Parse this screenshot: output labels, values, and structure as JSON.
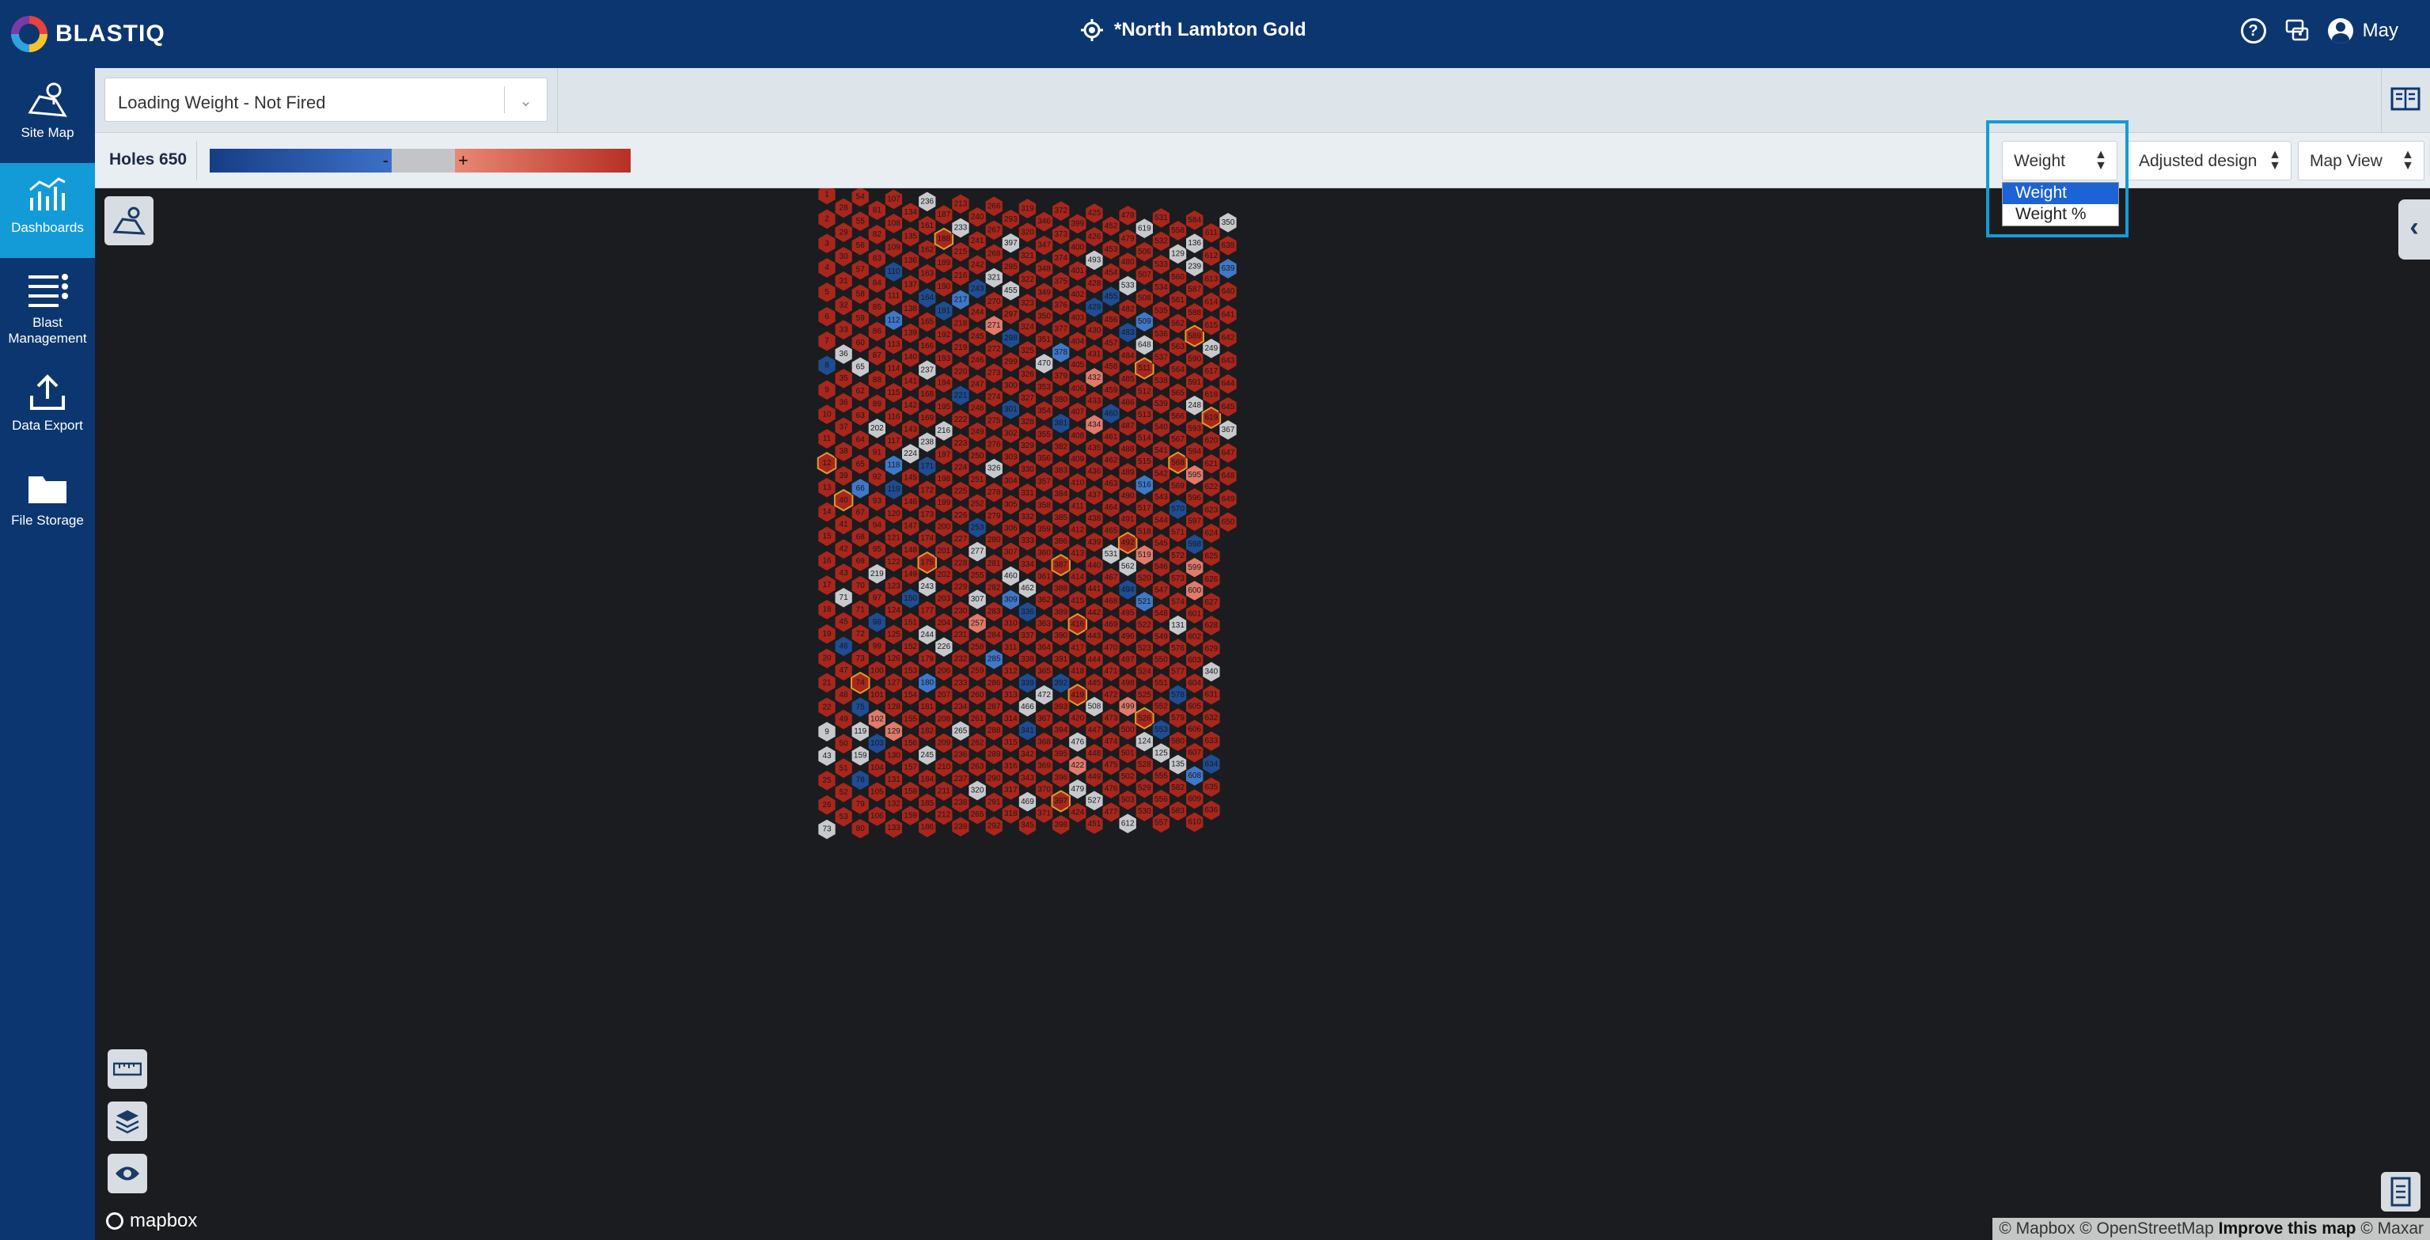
{
  "app": {
    "logo_text": "BLASTIQ",
    "site_title": "*North Lambton Gold",
    "user_name": "May"
  },
  "sidebar": {
    "items": [
      {
        "label": "Site Map",
        "icon": "map-marker-icon"
      },
      {
        "label": "Dashboards",
        "icon": "dashboard-chart-icon"
      },
      {
        "label": "Blast Management",
        "icon": "list-settings-icon"
      },
      {
        "label": "Data Export",
        "icon": "upload-icon"
      },
      {
        "label": "File Storage",
        "icon": "folder-icon"
      }
    ]
  },
  "toolbar": {
    "dashboard_select": "Loading Weight - Not Fired"
  },
  "legend": {
    "holes_label": "Holes 650",
    "minus": "-",
    "plus": "+"
  },
  "controls": {
    "metric_select": "Weight",
    "metric_options": [
      "Weight",
      "Weight %"
    ],
    "design_select": "Adjusted design",
    "view_select": "Map View"
  },
  "map": {
    "mapbox_label": "mapbox",
    "attribution_a": "© Mapbox © OpenStreetMap",
    "attribution_b": "Improve this map",
    "attribution_c": "© Maxar"
  },
  "colors": {
    "header": "#0c3670",
    "active_nav": "#139bd8",
    "over": "#a8261c",
    "near": "#e07a6b",
    "under": "#1f4c92",
    "under_light": "#3f78c9",
    "target": "#c7c9cc",
    "outline": "#e49a2a"
  },
  "hole_map": {
    "total": 650,
    "visible_labels": [
      "9",
      "43",
      "73",
      "36",
      "71",
      "65",
      "119",
      "159",
      "202",
      "219",
      "224",
      "236",
      "237",
      "238",
      "243",
      "244",
      "245",
      "216",
      "226",
      "233",
      "265",
      "277",
      "307",
      "320",
      "321",
      "326",
      "397",
      "455",
      "460",
      "462",
      "466",
      "469",
      "470",
      "472",
      "476",
      "479",
      "493",
      "508",
      "527",
      "531",
      "533",
      "562",
      "612",
      "619",
      "648",
      "124",
      "125",
      "129",
      "131",
      "135",
      "136",
      "239",
      "248",
      "249",
      "340",
      "350",
      "367",
      "414",
      "415",
      "456",
      "457",
      "473",
      "535",
      "537",
      "561",
      "626",
      "21",
      "22",
      "30",
      "31",
      "38",
      "58",
      "60",
      "200",
      "225"
    ]
  }
}
